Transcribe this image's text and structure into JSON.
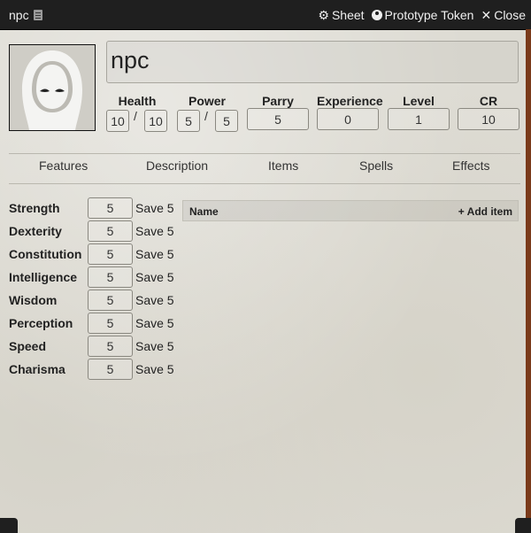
{
  "window": {
    "title": "npc"
  },
  "header_actions": {
    "sheet": "Sheet",
    "prototype_token": "Prototype Token",
    "close": "Close"
  },
  "actor": {
    "name": "npc"
  },
  "stats": {
    "health": {
      "label": "Health",
      "value": "10",
      "max": "10"
    },
    "power": {
      "label": "Power",
      "value": "5",
      "max": "5"
    },
    "parry": {
      "label": "Parry",
      "value": "5"
    },
    "experience": {
      "label": "Experience",
      "value": "0"
    },
    "level": {
      "label": "Level",
      "value": "1"
    },
    "cr": {
      "label": "CR",
      "value": "10"
    },
    "separator": "/"
  },
  "tabs": [
    "Features",
    "Description",
    "Items",
    "Spells",
    "Effects"
  ],
  "attributes": [
    {
      "label": "Strength",
      "value": "5",
      "save": "Save 5"
    },
    {
      "label": "Dexterity",
      "value": "5",
      "save": "Save 5"
    },
    {
      "label": "Constitution",
      "value": "5",
      "save": "Save 5"
    },
    {
      "label": "Intelligence",
      "value": "5",
      "save": "Save 5"
    },
    {
      "label": "Wisdom",
      "value": "5",
      "save": "Save 5"
    },
    {
      "label": "Perception",
      "value": "5",
      "save": "Save 5"
    },
    {
      "label": "Speed",
      "value": "5",
      "save": "Save 5"
    },
    {
      "label": "Charisma",
      "value": "5",
      "save": "Save 5"
    }
  ],
  "items_table": {
    "name_header": "Name",
    "add_item": "+ Add item"
  },
  "icons": {
    "sheet": "gear-icon",
    "prototype_token": "user-circle-icon",
    "close": "close-icon"
  },
  "colors": {
    "titlebar": "#1f1f1f",
    "parchment": "#dddbd3",
    "accent_strip": "#7a3a1a"
  }
}
